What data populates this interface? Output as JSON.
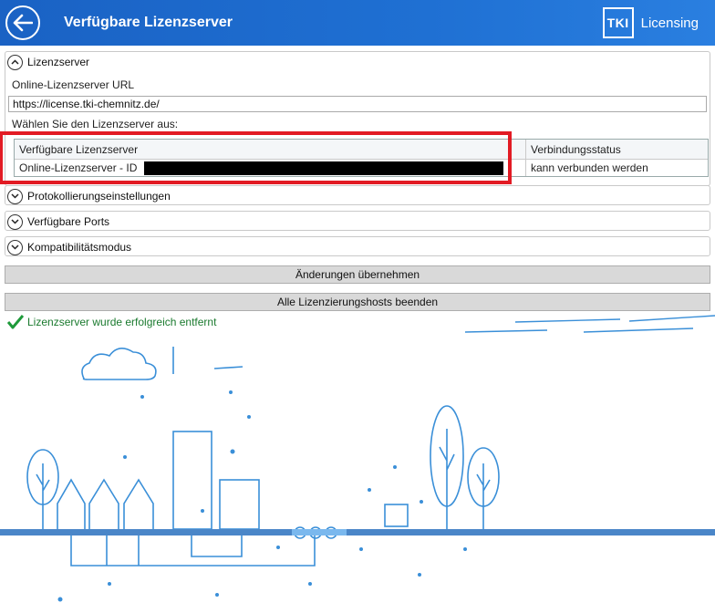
{
  "header": {
    "title": "Verfügbare Lizenzserver",
    "brand_logo": "TKI",
    "brand_name": "Licensing",
    "back_icon": "arrow-left-icon"
  },
  "lizenzserver_section": {
    "title": "Lizenzserver",
    "url_label": "Online-Lizenzserver URL",
    "url_value": "https://license.tki-chemnitz.de/",
    "select_label": "Wählen Sie den Lizenzserver aus:",
    "table": {
      "columns": [
        "Verfügbare Lizenzserver",
        "Verbindungsstatus"
      ],
      "rows": [
        {
          "server": "Online-Lizenzserver - ID",
          "status": "kann verbunden werden"
        }
      ]
    }
  },
  "collapsed_sections": [
    {
      "title": "Protokollierungseinstellungen"
    },
    {
      "title": "Verfügbare Ports"
    },
    {
      "title": "Kompatibilitätsmodus"
    }
  ],
  "buttons": {
    "apply": "Änderungen übernehmen",
    "stop_hosts": "Alle Lizenzierungshosts beenden"
  },
  "status_message": "Lizenzserver wurde erfolgreich entfernt",
  "colors": {
    "header_blue": "#1f70d3",
    "highlight_red": "#e21b24",
    "success_green": "#1a7a2e",
    "illustration_blue": "#3a8fd8"
  }
}
